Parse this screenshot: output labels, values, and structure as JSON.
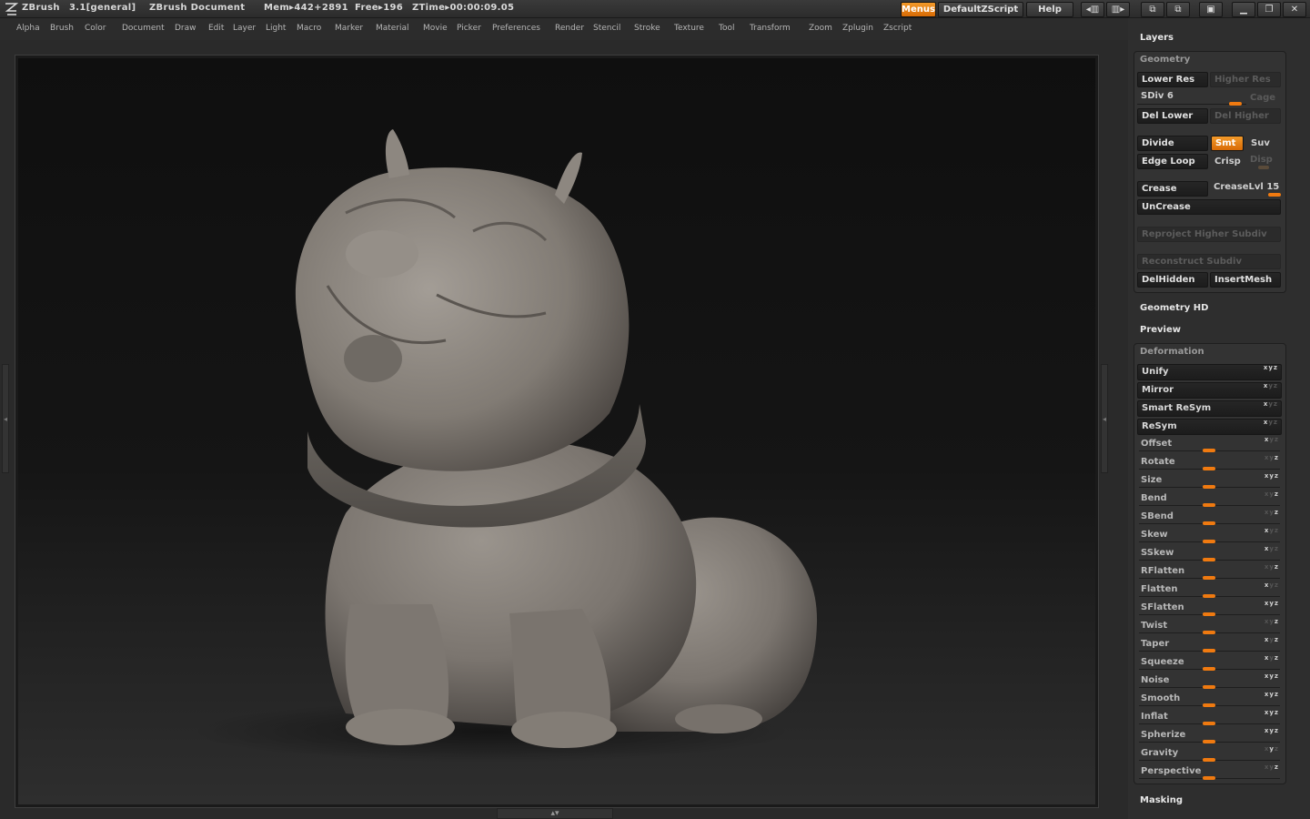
{
  "titlebar": {
    "app_name": "ZBrush",
    "version": "3.1[general]",
    "document": "ZBrush Document",
    "mem": "Mem▸442+2891",
    "free": "Free▸196",
    "ztime": "ZTime▸00:00:09.05",
    "menus_btn": "Menus",
    "script_btn": "DefaultZScript",
    "help_btn": "Help"
  },
  "menubar": {
    "items": [
      "Alpha",
      "Brush",
      "Color",
      "Document",
      "Draw",
      "Edit",
      "Layer",
      "Light",
      "Macro",
      "Marker",
      "Material",
      "Movie",
      "Picker",
      "Preferences",
      "Render",
      "Stencil",
      "Stroke",
      "Texture",
      "Tool",
      "Transform",
      "Zoom",
      "Zplugin",
      "Zscript"
    ]
  },
  "panel": {
    "layers": "Layers",
    "geometry": {
      "title": "Geometry",
      "lower_res": "Lower Res",
      "higher_res": "Higher Res",
      "sdiv_label": "SDiv 6",
      "cage": "Cage",
      "del_lower": "Del Lower",
      "del_higher": "Del Higher",
      "divide": "Divide",
      "smt": "Smt",
      "suv": "Suv",
      "edge_loop": "Edge Loop",
      "crisp": "Crisp",
      "disp": "Disp",
      "crease": "Crease",
      "crease_lvl": "CreaseLvl 15",
      "uncrease": "UnCrease",
      "reproject": "Reproject Higher Subdiv",
      "reconstruct": "Reconstruct Subdiv",
      "delhidden": "DelHidden",
      "insertmesh": "InsertMesh"
    },
    "geometry_hd": "Geometry HD",
    "preview": "Preview",
    "deformation": {
      "title": "Deformation",
      "items": [
        {
          "label": "Unify",
          "axes": "xyz",
          "active": "xyz"
        },
        {
          "label": "Mirror",
          "axes": "xyz",
          "active": "x"
        },
        {
          "label": "Smart ReSym",
          "axes": "xyz",
          "active": "x"
        },
        {
          "label": "ReSym",
          "axes": "xyz",
          "active": "x"
        },
        {
          "label": "Offset",
          "axes": "xyz",
          "active": "x"
        },
        {
          "label": "Rotate",
          "axes": "xyz",
          "active": "z"
        },
        {
          "label": "Size",
          "axes": "xyz",
          "active": "xyz"
        },
        {
          "label": "Bend",
          "axes": "xyz",
          "active": "z"
        },
        {
          "label": "SBend",
          "axes": "xyz",
          "active": "z"
        },
        {
          "label": "Skew",
          "axes": "xyz",
          "active": "x"
        },
        {
          "label": "SSkew",
          "axes": "xyz",
          "active": "x"
        },
        {
          "label": "RFlatten",
          "axes": "xyz",
          "active": "z"
        },
        {
          "label": "Flatten",
          "axes": "xyz",
          "active": "x"
        },
        {
          "label": "SFlatten",
          "axes": "xyz",
          "active": "xyz"
        },
        {
          "label": "Twist",
          "axes": "xyz",
          "active": "z"
        },
        {
          "label": "Taper",
          "axes": "xyz",
          "active": "xz"
        },
        {
          "label": "Squeeze",
          "axes": "xyz",
          "active": "xz"
        },
        {
          "label": "Noise",
          "axes": "xyz",
          "active": "xyz"
        },
        {
          "label": "Smooth",
          "axes": "xyz",
          "active": "xyz"
        },
        {
          "label": "Inflat",
          "axes": "xyz",
          "active": "xyz"
        },
        {
          "label": "Spherize",
          "axes": "xyz",
          "active": "xyz"
        },
        {
          "label": "Gravity",
          "axes": "xyz",
          "active": "y"
        },
        {
          "label": "Perspective",
          "axes": "xyz",
          "active": "z"
        }
      ]
    },
    "masking": "Masking"
  },
  "colors": {
    "accent": "#f07a10",
    "panel_bg": "#2e2e2e",
    "canvas_bg": "#111111",
    "model": "#8a847d"
  },
  "icons": [
    "zbrush-logo-icon",
    "layout-prev-icon",
    "layout-next-icon",
    "scroll-icon",
    "lock-icon",
    "minimize-icon",
    "restore-icon",
    "close-icon"
  ]
}
